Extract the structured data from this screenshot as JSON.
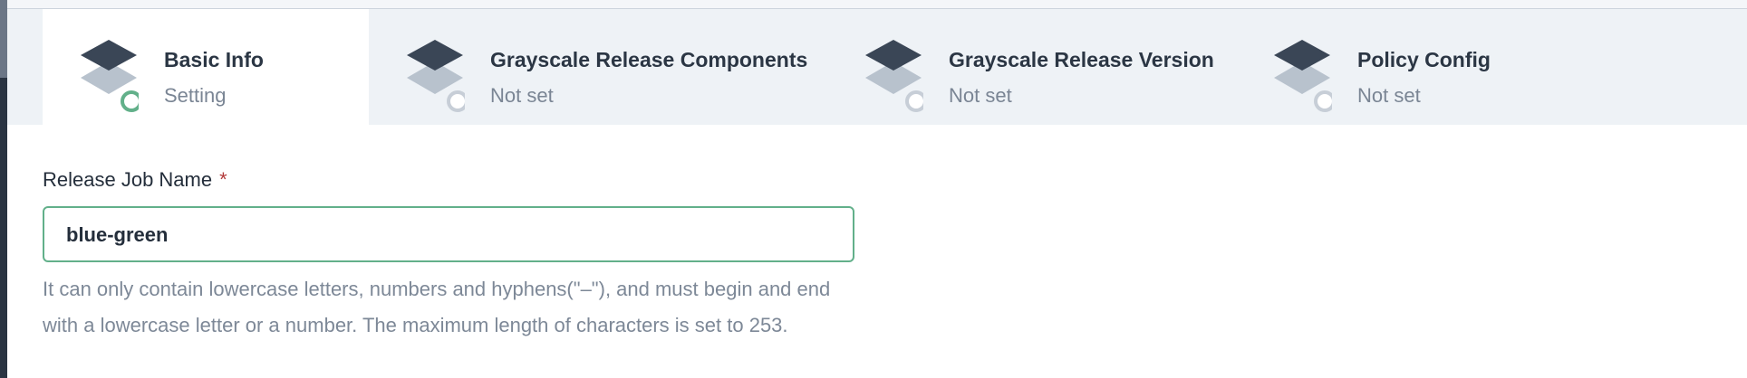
{
  "steps": [
    {
      "title": "Basic Info",
      "status": "Setting",
      "icon": "layers-icon",
      "active": true
    },
    {
      "title": "Grayscale Release Components",
      "status": "Not set",
      "icon": "layers-icon",
      "active": false
    },
    {
      "title": "Grayscale Release Version",
      "status": "Not set",
      "icon": "layers-icon",
      "active": false
    },
    {
      "title": "Policy Config",
      "status": "Not set",
      "icon": "layers-icon",
      "active": false
    }
  ],
  "form": {
    "label": "Release Job Name",
    "required_mark": "*",
    "value": "blue-green",
    "helper": "It can only contain lowercase letters, numbers and hyphens(\"–\"), and must begin and end with a lowercase letter or a number. The maximum length of characters is set to 253."
  },
  "colors": {
    "active_ring": "#62b08a",
    "inactive_ring": "#c7ced7",
    "icon_dark": "#3a4656",
    "icon_light": "#b8c2cd",
    "required": "#b33a3a"
  }
}
